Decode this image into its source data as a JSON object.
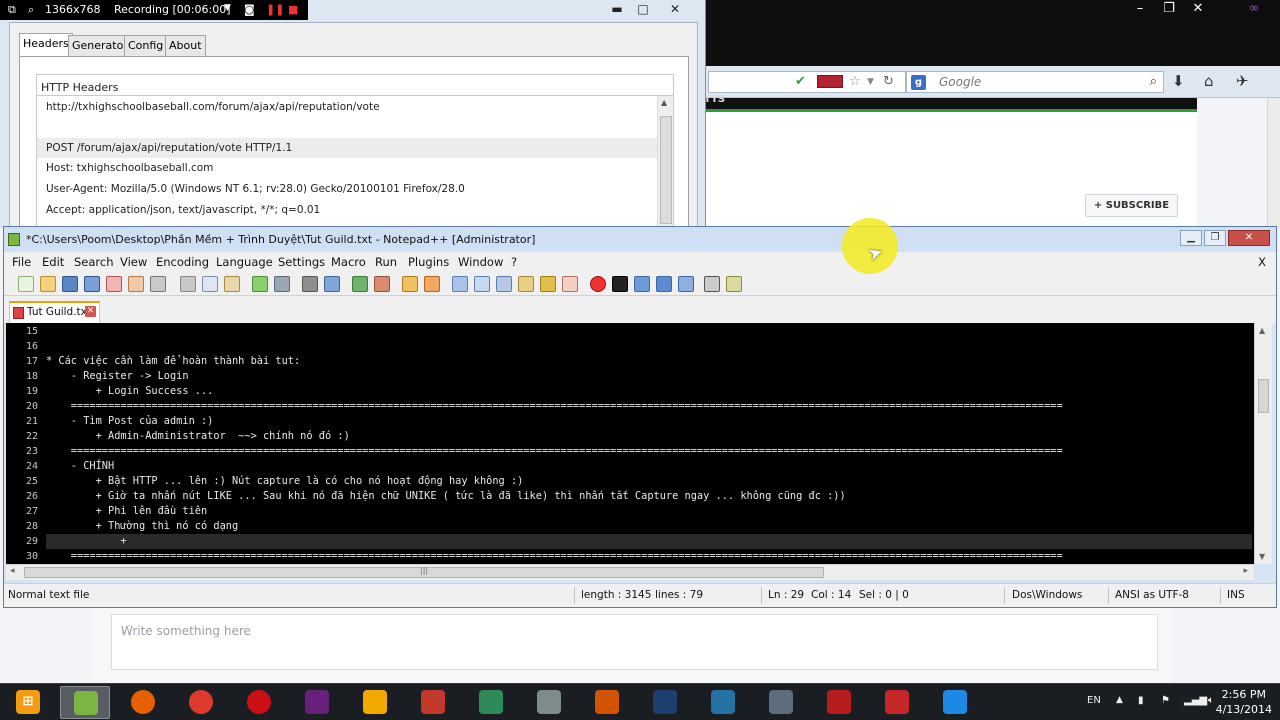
{
  "recorder": {
    "resolution": "1366x768",
    "status": "Recording [00:06:00]"
  },
  "http_window": {
    "tabs": [
      "Headers",
      "Generator",
      "Config",
      "About"
    ],
    "group_title": "HTTP Headers",
    "lines": [
      "http://txhighschoolbaseball.com/forum/ajax/api/reputation/vote",
      "",
      "POST /forum/ajax/api/reputation/vote HTTP/1.1",
      "Host: txhighschoolbaseball.com",
      "User-Agent: Mozilla/5.0 (Windows NT 6.1; rv:28.0) Gecko/20100101 Firefox/28.0",
      "Accept: application/json, text/javascript, */*; q=0.01"
    ]
  },
  "browser": {
    "search_placeholder": "Google",
    "subscribe_label": "+ SUBSCRIBE",
    "comment_placeholder": "Write something here"
  },
  "notepad": {
    "title": "*C:\\Users\\Poom\\Desktop\\Phần Mềm + Trình Duyệt\\Tut Guild.txt - Notepad++ [Administrator]",
    "menu": [
      "File",
      "Edit",
      "Search",
      "View",
      "Encoding",
      "Language",
      "Settings",
      "Macro",
      "Run",
      "Plugins",
      "Window",
      "?"
    ],
    "menu_close": "X",
    "tab_name": "Tut Guild.txt",
    "lines": [
      {
        "n": "15",
        "text": ""
      },
      {
        "n": "16",
        "text": ""
      },
      {
        "n": "17",
        "text": "* Các việc cần làm để hoàn thành bài tut:"
      },
      {
        "n": "18",
        "text": "    - Register -> Login"
      },
      {
        "n": "19",
        "text": "        + Login Success ..."
      },
      {
        "n": "20",
        "text": "    ================================================================================================================================================================"
      },
      {
        "n": "21",
        "text": "    - Tìm Post của admin :)"
      },
      {
        "n": "22",
        "text": "        + Admin-Administrator  ~~> chính nó đó :)"
      },
      {
        "n": "23",
        "text": "    ================================================================================================================================================================"
      },
      {
        "n": "24",
        "text": "    - CHÍNH"
      },
      {
        "n": "25",
        "text": "        + Bật HTTP ... lên :) Nút capture là có cho nó hoạt động hay không :)"
      },
      {
        "n": "26",
        "text": "        + Giờ ta nhấn nút LIKE ... Sau khi nó đã hiện chữ UNIKE ( tức là đã like) thì nhấn tắt Capture ngay ... không cũng đc :))"
      },
      {
        "n": "27",
        "text": "        + Phi lên đầu tiên"
      },
      {
        "n": "28",
        "text": "        + Thường thì nó có dạng"
      },
      {
        "n": "29",
        "text": "            +"
      },
      {
        "n": "30",
        "text": "    ================================================================================================================================================================"
      }
    ],
    "status": {
      "file_type": "Normal text file",
      "length": "length : 3145",
      "lines": "lines : 79",
      "ln": "Ln : 29",
      "col": "Col : 14",
      "sel": "Sel : 0 | 0",
      "eol": "Dos\\Windows",
      "encoding": "ANSI as UTF-8",
      "mode": "INS"
    }
  },
  "taskbar": {
    "language": "EN",
    "time": "2:56 PM",
    "date": "4/13/2014",
    "apps": [
      {
        "name": "notepadpp",
        "color": "#7bb543"
      },
      {
        "name": "firefox",
        "color": "#e66000"
      },
      {
        "name": "chrome",
        "color": "#dd3b2e"
      },
      {
        "name": "opera",
        "color": "#cc0f16"
      },
      {
        "name": "visual-studio",
        "color": "#68217a"
      },
      {
        "name": "colorful-app",
        "color": "#f2a900"
      },
      {
        "name": "unikey",
        "color": "#c0392b"
      },
      {
        "name": "network-app",
        "color": "#2e8b57"
      },
      {
        "name": "paint-app",
        "color": "#7f8c8d"
      },
      {
        "name": "tools-app",
        "color": "#d35400"
      },
      {
        "name": "photoshop",
        "color": "#1c3f6e"
      },
      {
        "name": "vpn-app",
        "color": "#2471a3"
      },
      {
        "name": "fiddler-app",
        "color": "#5d6d7e"
      },
      {
        "name": "recorder-app",
        "color": "#b71c1c"
      },
      {
        "name": "speed-app",
        "color": "#c62828"
      },
      {
        "name": "ccleaner-app",
        "color": "#1e88e5"
      }
    ]
  }
}
